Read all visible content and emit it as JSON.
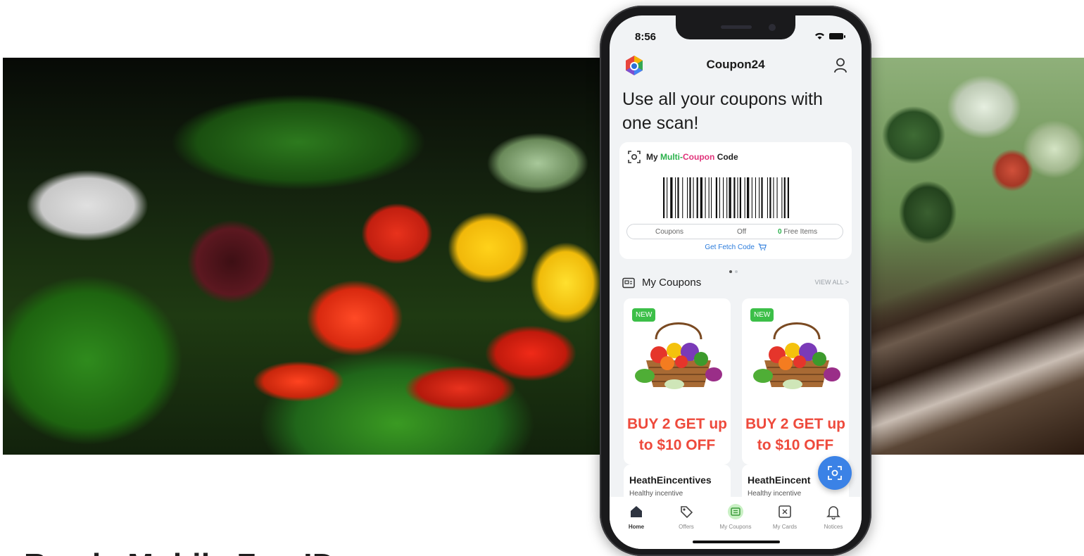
{
  "status_bar": {
    "time": "8:56"
  },
  "app": {
    "title": "Coupon24"
  },
  "hero": {
    "headline": "Use all your coupons with one scan!"
  },
  "code_card": {
    "label_prefix": "My",
    "label_multi": "Multi-",
    "label_coupon": "Coupon",
    "label_suffix": "Code",
    "coupons_label": "Coupons",
    "off_label": "Off",
    "free_count": "0",
    "free_label": "Free Items",
    "fetch_link": "Get Fetch Code"
  },
  "section": {
    "title": "My Coupons",
    "view_all": "VIEW ALL >"
  },
  "coupons": [
    {
      "badge": "NEW",
      "line1": "BUY 2 GET up",
      "line2": "to $10 OFF"
    },
    {
      "badge": "NEW",
      "line1": "BUY 2 GET up",
      "line2": "to $10 OFF"
    }
  ],
  "vendors": [
    {
      "name": "HeathEincentives",
      "sub": "Healthy incentive"
    },
    {
      "name": "HeathEincent",
      "sub": "Healthy incentive"
    }
  ],
  "tabs": [
    {
      "label": "Home",
      "icon": "home-icon"
    },
    {
      "label": "Offers",
      "icon": "tag-icon"
    },
    {
      "label": "My Coupons",
      "icon": "coupons-icon"
    },
    {
      "label": "My Cards",
      "icon": "card-icon"
    },
    {
      "label": "Notices",
      "icon": "bell-icon"
    }
  ],
  "page": {
    "heading": "Ready Mobile Fun ID"
  },
  "colors": {
    "accent_blue": "#3b82e6",
    "offer_red": "#ee4a3c",
    "badge_green": "#3cbf48",
    "link_blue": "#2a7bdc"
  }
}
